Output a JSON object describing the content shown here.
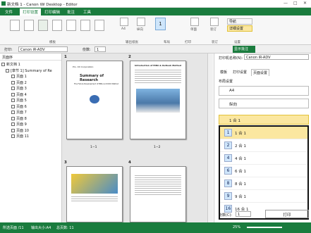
{
  "window": {
    "title": "新文档 1 - Canon iW Desktop - Editor",
    "min": "—",
    "max": "□",
    "close": "✕"
  },
  "menu": [
    "文件",
    "打印设置",
    "打印编辑",
    "批注",
    "工具"
  ],
  "ribbon": {
    "labels": [
      "A4",
      "纵向",
      "1",
      "单面",
      "装订",
      "导航",
      "详细设置"
    ],
    "groups": [
      "模板",
      "输出纸张",
      "布局",
      "打印",
      "装订",
      "设置"
    ]
  },
  "cmd": {
    "printer_label": "打印:",
    "printer": "Canon iR-ADV",
    "copies_label": "份数:",
    "copies": "1",
    "show_comment": "显示批注"
  },
  "left": {
    "header": "页面序",
    "doc": "新文档 1",
    "chapter": "[章节 1] Summary of Re",
    "pages": [
      "页面 1",
      "页面 2",
      "页面 3",
      "页面 4",
      "页面 5",
      "页面 6",
      "页面 7",
      "页面 8",
      "页面 9",
      "页面 10",
      "页面 11"
    ]
  },
  "center": {
    "sheet1": "1",
    "sheet2": "2",
    "sheet3": "3",
    "sheet4": "4",
    "label1": "1−1",
    "label2": "1−2",
    "p1_company": "Pro. XX Corporation",
    "p1_title": "Summary of Research",
    "p1_sub": "The Future Development of EIBA & XXXXX Method",
    "p2_title": "Introduction of EIBA & Outlook Method"
  },
  "right": {
    "printer_label": "打印机名称(N):",
    "printer": "Canon iR-ADV",
    "tabs": [
      "模板",
      "打印设置",
      "页面设置"
    ],
    "layout_label": "布局设置",
    "paper": "A4",
    "orient": "纵向",
    "nup_selected": "1 合 1",
    "nup": [
      {
        "n": "1",
        "label": "1 合 1"
      },
      {
        "n": "2",
        "label": "2 合 1"
      },
      {
        "n": "4",
        "label": "4 合 1"
      },
      {
        "n": "6",
        "label": "6 合 1"
      },
      {
        "n": "8",
        "label": "8 合 1"
      },
      {
        "n": "9",
        "label": "9 合 1"
      },
      {
        "n": "16",
        "label": "16 合 1"
      }
    ],
    "copies_label": "份数(C):",
    "copies": "1",
    "print": "打印"
  },
  "status": {
    "pages": "所选页面 /11",
    "paper": "输出大小:A4",
    "count": "总页数: 11",
    "zoom": "25%"
  }
}
